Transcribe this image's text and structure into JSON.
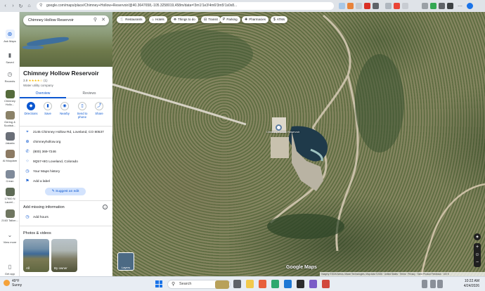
{
  "browser": {
    "url": "google.com/maps/place/Chimney+Hollow+Reservoir/@40.3647658,-105.3258019,458m/data=!3m1!1e3!4m6!3m5!1s0x8..."
  },
  "rail": {
    "items": [
      {
        "label": "Ask Maps"
      },
      {
        "label": "Saved"
      },
      {
        "label": "Recents"
      },
      {
        "label": "Chimney Hollo..."
      },
      {
        "label": "Gering & Scottsb..."
      },
      {
        "label": "Jakarta"
      },
      {
        "label": "Al Muqdam"
      },
      {
        "label": "Crean"
      },
      {
        "label": "17900 N Laurel..."
      },
      {
        "label": "2163 Tallon..."
      },
      {
        "label": "View more"
      },
      {
        "label": "Get app"
      }
    ]
  },
  "panel": {
    "search_value": "Chimney Hollow Reservoir",
    "title": "Chimney Hollow Reservoir",
    "rating": "3.9",
    "stars": "★★★★☆",
    "review_count": "(1)",
    "type": "Water utility company",
    "tabs": [
      {
        "label": "Overview"
      },
      {
        "label": "Reviews"
      }
    ],
    "actions": [
      {
        "label": "Directions",
        "icon": "◆"
      },
      {
        "label": "Save",
        "icon": "▮"
      },
      {
        "label": "Nearby",
        "icon": "◉"
      },
      {
        "label": "Send to phone",
        "icon": "▯"
      },
      {
        "label": "Share",
        "icon": "⤴"
      }
    ],
    "info": [
      {
        "text": "2145 Chimney Hollow Rd, Loveland, CO 80537",
        "icon": "⌖"
      },
      {
        "text": "chimneyhollow.org",
        "icon": "⊕"
      },
      {
        "text": "(800) 369-7246",
        "icon": "✆"
      },
      {
        "text": "9Q57+8G Loveland, Colorado",
        "icon": "⁘"
      },
      {
        "text": "Your Maps history",
        "icon": "◷"
      },
      {
        "text": "Add a label",
        "icon": "⚑"
      }
    ],
    "suggest_edit": "Suggest an edit",
    "add_missing": "Add missing information",
    "add_hours": "Add hours",
    "photos_heading": "Photos & videos",
    "photos": [
      {
        "label": "All"
      },
      {
        "label": "By owner"
      }
    ]
  },
  "map": {
    "chips": [
      {
        "label": "Restaurants",
        "icon": "🍴"
      },
      {
        "label": "Hotels",
        "icon": "⌂"
      },
      {
        "label": "Things to do",
        "icon": "⛯"
      },
      {
        "label": "Transit",
        "icon": "⊟"
      },
      {
        "label": "Parking",
        "icon": "P"
      },
      {
        "label": "Pharmacies",
        "icon": "✚"
      },
      {
        "label": "ATMs",
        "icon": "$"
      }
    ],
    "layers_label": "Layers",
    "watermark": "Google Maps",
    "attribution": "Imagery ©2026 Airbus, Maxar Technologies, Map data ©2026 · United States · Terms · Privacy · Send Product Feedback · 100 ft",
    "place_label": "Chimney Hollow Reservoir"
  },
  "taskbar": {
    "temp": "49°F",
    "condition": "Sunny",
    "search_placeholder": "Search",
    "time": "10:22 AM",
    "date": "4/24/2026"
  }
}
